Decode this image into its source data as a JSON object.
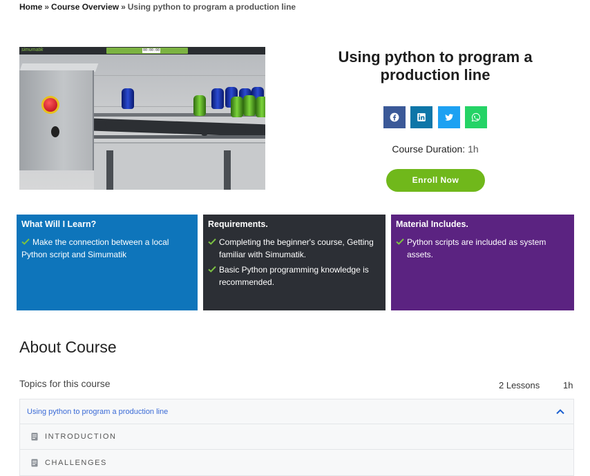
{
  "breadcrumb": {
    "home": "Home",
    "separator": "»",
    "overview": "Course Overview",
    "current": "Using python to program a production line"
  },
  "thumbnail": {
    "brand": "simumatik",
    "timer": "00:00:00"
  },
  "course": {
    "title": "Using python to program a production line",
    "duration_label": "Course Duration:",
    "duration_value": "1h",
    "enroll_label": "Enroll Now"
  },
  "share": {
    "icons": [
      "facebook-icon",
      "linkedin-icon",
      "twitter-icon",
      "whatsapp-icon"
    ],
    "colors": {
      "facebook": "#3b5998",
      "linkedin": "#0e76a8",
      "twitter": "#1da1f2",
      "whatsapp": "#25d366"
    }
  },
  "learn": {
    "heading": "What Will I Learn?",
    "items": [
      "Make the connection between a local Python script and Simumatik"
    ]
  },
  "requirements": {
    "heading": "Requirements.",
    "items": [
      "Completing the beginner's course, Getting familiar with Simumatik.",
      "Basic Python programming knowledge is recommended."
    ]
  },
  "materials": {
    "heading": "Material Includes.",
    "items": [
      "Python scripts are included as system assets."
    ]
  },
  "about": {
    "heading": "About Course",
    "topics_label": "Topics for this course",
    "lessons_count": "2 Lessons",
    "total_time": "1h"
  },
  "topic": {
    "title": "Using python to program a production line",
    "lessons": [
      "INTRODUCTION",
      "CHALLENGES"
    ]
  },
  "colors": {
    "learn_bg": "#0e75bb",
    "requirements_bg": "#2c2f35",
    "materials_bg": "#5b2381",
    "check": "#7cc242",
    "enroll_bg": "#70b81b"
  }
}
